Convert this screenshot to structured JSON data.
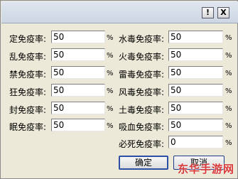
{
  "titlebar": {
    "help_label": "!",
    "close_label": "X"
  },
  "left_fields": [
    {
      "label": "定免疫率:",
      "value": "50",
      "unit": "%"
    },
    {
      "label": "乱免疫率:",
      "value": "50",
      "unit": "%"
    },
    {
      "label": "禁免疫率:",
      "value": "50",
      "unit": "%"
    },
    {
      "label": "狂免疫率:",
      "value": "50",
      "unit": "%"
    },
    {
      "label": "封免疫率:",
      "value": "50",
      "unit": "%"
    },
    {
      "label": "眠免疫率:",
      "value": "50",
      "unit": "%"
    }
  ],
  "right_fields": [
    {
      "label": "水毒免疫率:",
      "value": "50",
      "unit": "%"
    },
    {
      "label": "火毒免疫率:",
      "value": "50",
      "unit": "%"
    },
    {
      "label": "雷毒免疫率:",
      "value": "50",
      "unit": "%"
    },
    {
      "label": "风毒免疫率:",
      "value": "50",
      "unit": "%"
    },
    {
      "label": "土毒免疫率:",
      "value": "50",
      "unit": "%"
    },
    {
      "label": "吸血免疫率:",
      "value": "50",
      "unit": "%"
    },
    {
      "label": "必死免疫率:",
      "value": "0",
      "unit": "%"
    }
  ],
  "buttons": {
    "ok": "确定",
    "cancel": "取消"
  },
  "watermark": "东华手游网"
}
